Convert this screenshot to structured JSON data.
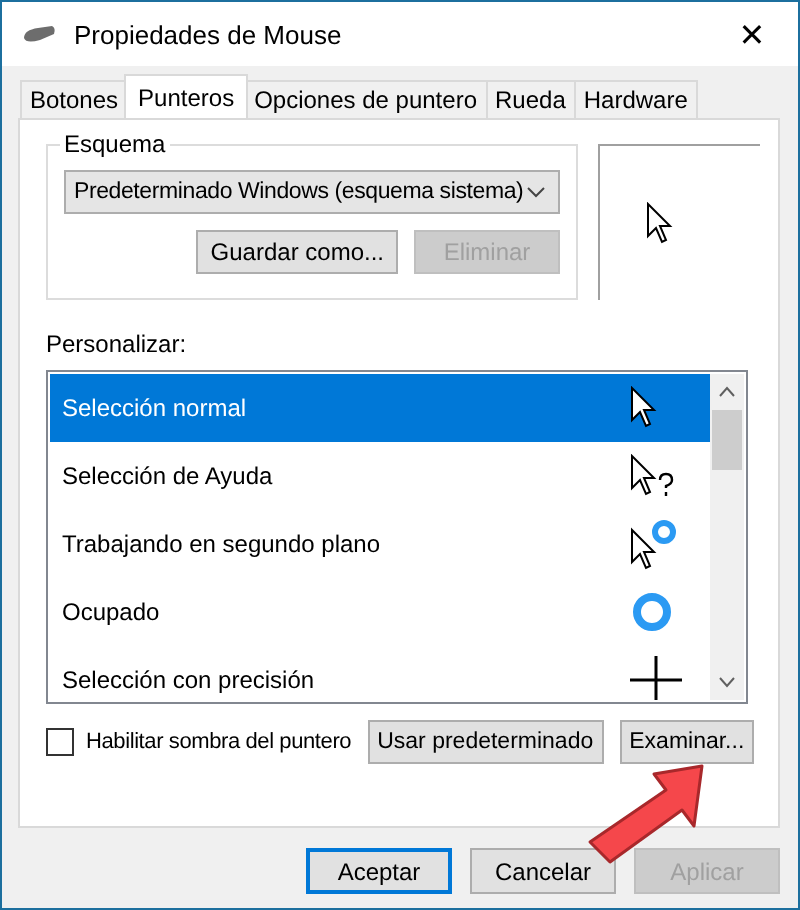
{
  "window": {
    "title": "Propiedades de Mouse",
    "close": "✕"
  },
  "tabs": [
    {
      "label": "Botones",
      "selected": false
    },
    {
      "label": "Punteros",
      "selected": true
    },
    {
      "label": "Opciones de puntero",
      "selected": false
    },
    {
      "label": "Rueda",
      "selected": false
    },
    {
      "label": "Hardware",
      "selected": false
    }
  ],
  "scheme": {
    "label": "Esquema",
    "value": "Predeterminado Windows (esquema sistema)",
    "buttons": [
      {
        "label": "Guardar como...",
        "disabled": false
      },
      {
        "label": "Eliminar",
        "disabled": true
      }
    ]
  },
  "customize": {
    "label": "Personalizar:",
    "items": [
      {
        "label": "Selección normal",
        "selected": true,
        "kind": "arrow"
      },
      {
        "label": "Selección de Ayuda",
        "selected": false,
        "kind": "help"
      },
      {
        "label": "Trabajando en segundo plano",
        "selected": false,
        "kind": "working"
      },
      {
        "label": "Ocupado",
        "selected": false,
        "kind": "busy"
      },
      {
        "label": "Selección con precisión",
        "selected": false,
        "kind": "precision"
      }
    ]
  },
  "shadow_checkbox": {
    "label": "Habilitar sombra del puntero",
    "checked": false
  },
  "pointer_buttons": [
    "Usar predeterminado",
    "Examinar..."
  ],
  "dialog_buttons": [
    {
      "label": "Aceptar",
      "default": true,
      "disabled": false
    },
    {
      "label": "Cancelar",
      "default": false,
      "disabled": false
    },
    {
      "label": "Aplicar",
      "default": false,
      "disabled": true
    }
  ]
}
